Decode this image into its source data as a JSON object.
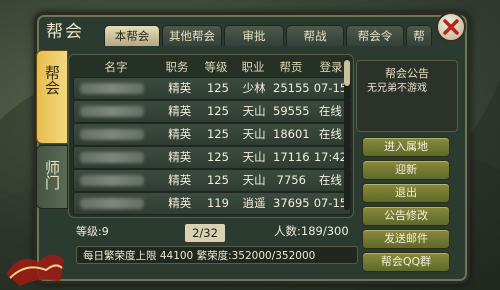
{
  "title": "帮会",
  "tabs": [
    "本帮会",
    "其他帮会",
    "审批",
    "帮战",
    "帮会令",
    "帮"
  ],
  "side_tabs": [
    "帮会",
    "师门"
  ],
  "table": {
    "headers": [
      "名字",
      "职务",
      "等级",
      "职业",
      "帮贡",
      "登录"
    ],
    "rows": [
      {
        "pos": "精英",
        "lvl": "125",
        "job": "少林",
        "con": "25155",
        "log": "07-15"
      },
      {
        "pos": "精英",
        "lvl": "125",
        "job": "天山",
        "con": "59555",
        "log": "在线"
      },
      {
        "pos": "精英",
        "lvl": "125",
        "job": "天山",
        "con": "18601",
        "log": "在线"
      },
      {
        "pos": "精英",
        "lvl": "125",
        "job": "天山",
        "con": "17116",
        "log": "17:42"
      },
      {
        "pos": "精英",
        "lvl": "125",
        "job": "天山",
        "con": "7756",
        "log": "在线"
      },
      {
        "pos": "精英",
        "lvl": "119",
        "job": "逍遥",
        "con": "37695",
        "log": "07-15"
      }
    ]
  },
  "notice": {
    "title": "帮会公告",
    "body": "无兄弟不游戏"
  },
  "buttons": [
    "进入属地",
    "迎新",
    "退出",
    "公告修改",
    "发送邮件",
    "帮会QQ群"
  ],
  "level_label": "等级:9",
  "page": "2/32",
  "members": "人数:189/300",
  "status_bar": "每日繁荣度上限 44100  繁荣度:352000/352000",
  "colors": {
    "accent_gold": "#e6be4d",
    "button_green": "#6f7a30",
    "panel": "#2c3b30"
  }
}
